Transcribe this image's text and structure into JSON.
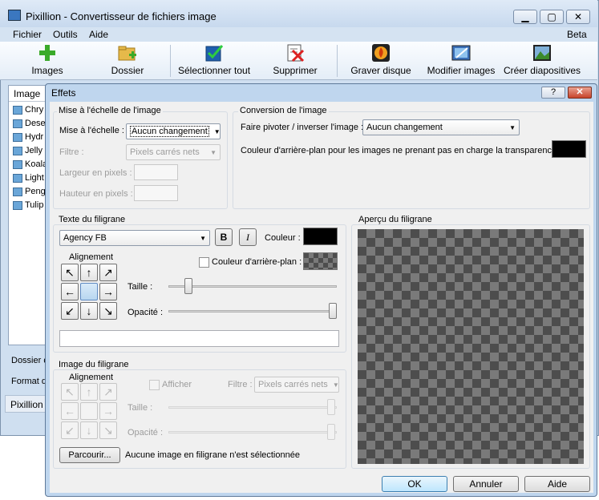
{
  "window": {
    "title": "Pixillion - Convertisseur de fichiers image",
    "beta": "Beta",
    "min": "▭",
    "max": "▢",
    "close": "✕"
  },
  "menu": [
    "Fichier",
    "Outils",
    "Aide"
  ],
  "toolbar": [
    {
      "label": "Images",
      "icon": "add-images-icon"
    },
    {
      "label": "Dossier",
      "icon": "add-folder-icon"
    },
    {
      "label": "Sélectionner tout",
      "icon": "select-all-icon"
    },
    {
      "label": "Supprimer",
      "icon": "delete-icon"
    },
    {
      "label": "Graver disque",
      "icon": "burn-disc-icon"
    },
    {
      "label": "Modifier images",
      "icon": "edit-images-icon"
    },
    {
      "label": "Créer diapositives",
      "icon": "slideshow-icon"
    }
  ],
  "file_list": {
    "header": "Image",
    "items": [
      "Chry",
      "Dese",
      "Hydr",
      "Jelly",
      "Koala",
      "Light",
      "Peng",
      "Tulip"
    ]
  },
  "side_labels": {
    "output_folder": "Dossier d",
    "format": "Format d"
  },
  "status": "Pixillion",
  "dialog": {
    "title": "Effets",
    "help": "?",
    "close": "✕",
    "scale": {
      "group": "Mise à l'échelle de l'image",
      "scale_label": "Mise à l'échelle :",
      "scale_value": "Aucun changement",
      "filter_label": "Filtre :",
      "filter_value": "Pixels carrés nets",
      "width_label": "Largeur en pixels :",
      "height_label": "Hauteur en pixels :"
    },
    "conversion": {
      "group": "Conversion de l'image",
      "rotate_label": "Faire pivoter / inverser l'image :",
      "rotate_value": "Aucun changement",
      "bg_label": "Couleur d'arrière-plan pour les images ne prenant pas en charge la transparence :",
      "bg_color": "#000000"
    },
    "text_wm": {
      "group": "Texte du filigrane",
      "font": "Agency FB",
      "bold": "B",
      "italic": "I",
      "color_label": "Couleur :",
      "color": "#000000",
      "align_label": "Alignement",
      "bg_checkbox": "Couleur d'arrière-plan :",
      "size_label": "Taille :",
      "opacity_label": "Opacité :",
      "size_value": 0.1,
      "opacity_value": 1.0,
      "text_value": ""
    },
    "preview": {
      "group": "Aperçu du filigrane"
    },
    "image_wm": {
      "group": "Image du filigrane",
      "align_label": "Alignement",
      "show_label": "Afficher",
      "filter_label": "Filtre :",
      "filter_value": "Pixels carrés nets",
      "size_label": "Taille :",
      "opacity_label": "Opacité :",
      "browse": "Parcourir...",
      "none_selected": "Aucune image en filigrane n'est sélectionnée"
    },
    "buttons": {
      "ok": "OK",
      "cancel": "Annuler",
      "help": "Aide"
    }
  },
  "arrows": [
    "↖",
    "↑",
    "↗",
    "←",
    "",
    "→",
    "↙",
    "↓",
    "↘"
  ]
}
